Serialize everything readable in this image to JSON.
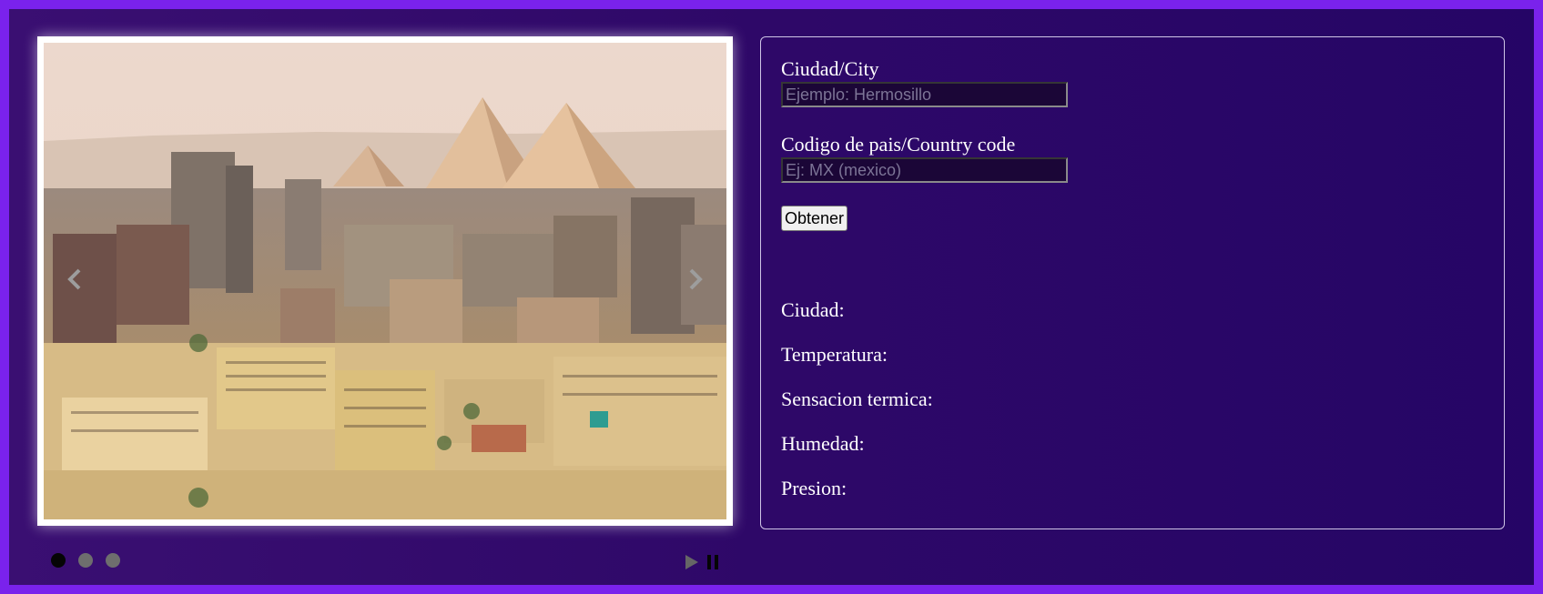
{
  "slider": {
    "image_alt": "Cairo skyline with the pyramids of Giza",
    "dots": [
      {
        "active": true
      },
      {
        "active": false
      },
      {
        "active": false
      }
    ],
    "icons": {
      "prev": "chevron-left-icon",
      "next": "chevron-right-icon",
      "play": "play-icon",
      "pause": "pause-icon"
    }
  },
  "form": {
    "city_label": "Ciudad/City",
    "city_placeholder": "Ejemplo: Hermosillo",
    "city_value": "",
    "country_label": "Codigo de pais/Country code",
    "country_placeholder": "Ej: MX (mexico)",
    "country_value": "",
    "submit_label": "Obtener"
  },
  "results": {
    "city_label": "Ciudad:",
    "temperature_label": "Temperatura:",
    "feels_like_label": "Sensacion termica:",
    "humidity_label": "Humedad:",
    "pressure_label": "Presion:"
  },
  "colors": {
    "page_border": "#7a22ec",
    "background": "#2e0868",
    "text": "#ffffff",
    "dot_active": "#050505",
    "dot_inactive": "#6e6e6e"
  }
}
